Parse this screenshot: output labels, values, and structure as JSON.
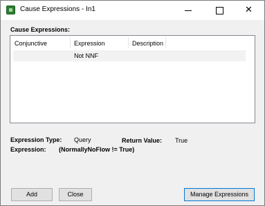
{
  "window": {
    "title": "Cause Expressions - In1",
    "icon": "app-icon",
    "minimize_glyph": "",
    "close_glyph": "✕"
  },
  "section": {
    "label": "Cause Expressions:"
  },
  "table": {
    "columns": [
      "Conjunctive",
      "Expression",
      "Description"
    ],
    "rows": [
      {
        "conjunctive": "",
        "expression": "Not NNF",
        "description": ""
      }
    ]
  },
  "details": {
    "expression_type_label": "Expression Type:",
    "expression_type_value": "Query",
    "return_value_label": "Return Value:",
    "return_value_value": "True",
    "expression_label": "Expression:",
    "expression_value": "(NormallyNoFlow != True)"
  },
  "buttons": {
    "add": "Add",
    "close": "Close",
    "manage": "Manage Expressions"
  }
}
